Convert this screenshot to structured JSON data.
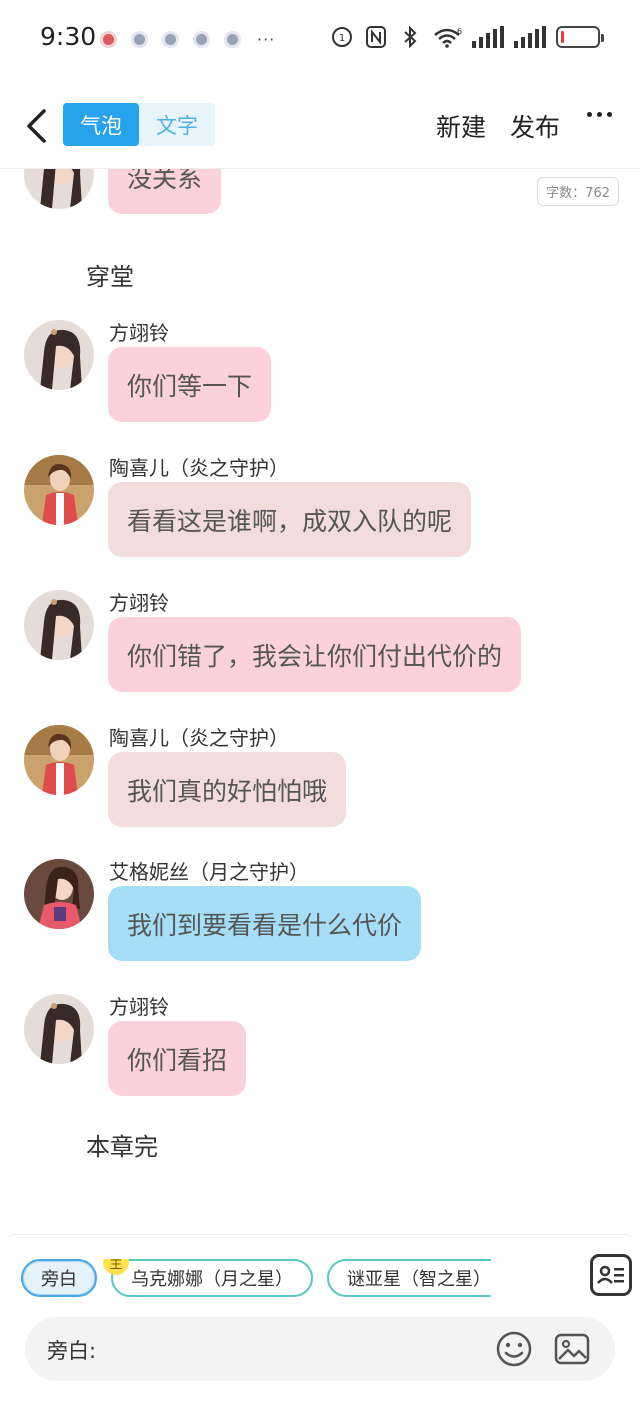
{
  "status_bar": {
    "time": "9:30",
    "more": "···",
    "network_badge": "6"
  },
  "header": {
    "tabs": [
      {
        "label": "气泡",
        "active": true
      },
      {
        "label": "文字",
        "active": false
      }
    ],
    "new_label": "新建",
    "publish_label": "发布",
    "more_icon": "more-horizontal-icon"
  },
  "word_count": "字数：762",
  "messages_top": {
    "partial_bubble": "没关系",
    "narration_1": "穿堂"
  },
  "messages": [
    {
      "sender": "方翊铃",
      "text": "你们等一下",
      "color": "#fbd2dc"
    },
    {
      "sender": "陶喜儿（炎之守护）",
      "text": "看看这是谁啊，成双入队的呢",
      "color": "#f2dcdc"
    },
    {
      "sender": "方翊铃",
      "text": "你们错了，我会让你们付出代价的",
      "color": "#fbd2dc"
    },
    {
      "sender": "陶喜儿（炎之守护）",
      "text": "我们真的好怕怕哦",
      "color": "#f2dcdc"
    },
    {
      "sender": "艾格妮丝（月之守护）",
      "text": "我们到要看看是什么代价",
      "color": "#a6ddf7"
    },
    {
      "sender": "方翊铃",
      "text": "你们看招",
      "color": "#fbd2dc"
    }
  ],
  "narration_end": "本章完",
  "composer": {
    "chips": [
      {
        "label": "旁白",
        "active": true
      },
      {
        "label": "乌克娜娜（月之星）",
        "badge": "主"
      },
      {
        "label": "谜亚星（智之星）"
      }
    ],
    "input_label": "旁白:",
    "input_value": "",
    "emoji_icon": "emoji-icon",
    "image_icon": "image-icon",
    "contacts_icon": "contact-card-icon"
  }
}
